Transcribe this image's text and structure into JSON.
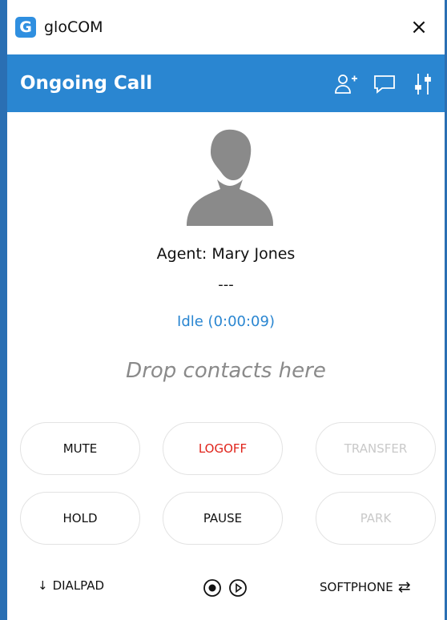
{
  "window": {
    "app_title": "gloCOM",
    "logo_letter": "G",
    "close_glyph": "×"
  },
  "header": {
    "title": "Ongoing Call",
    "icons": [
      "add-contact-icon",
      "chat-icon",
      "settings-sliders-icon"
    ]
  },
  "call": {
    "agent_label": "Agent: Mary Jones",
    "number": "---",
    "status": "Idle (0:00:09)",
    "drop_hint": "Drop contacts here"
  },
  "buttons": {
    "mute": "MUTE",
    "logoff": "LOGOFF",
    "transfer": "TRANSFER",
    "hold": "HOLD",
    "pause": "PAUSE",
    "park": "PARK"
  },
  "footer": {
    "dialpad": "DIALPAD",
    "softphone": "SOFTPHONE",
    "dialpad_arrow": "↓",
    "softphone_arrow": "⇄"
  },
  "colors": {
    "accent": "#2a86d1",
    "logoff": "#e0241b",
    "disabled": "#c9c9c9"
  }
}
